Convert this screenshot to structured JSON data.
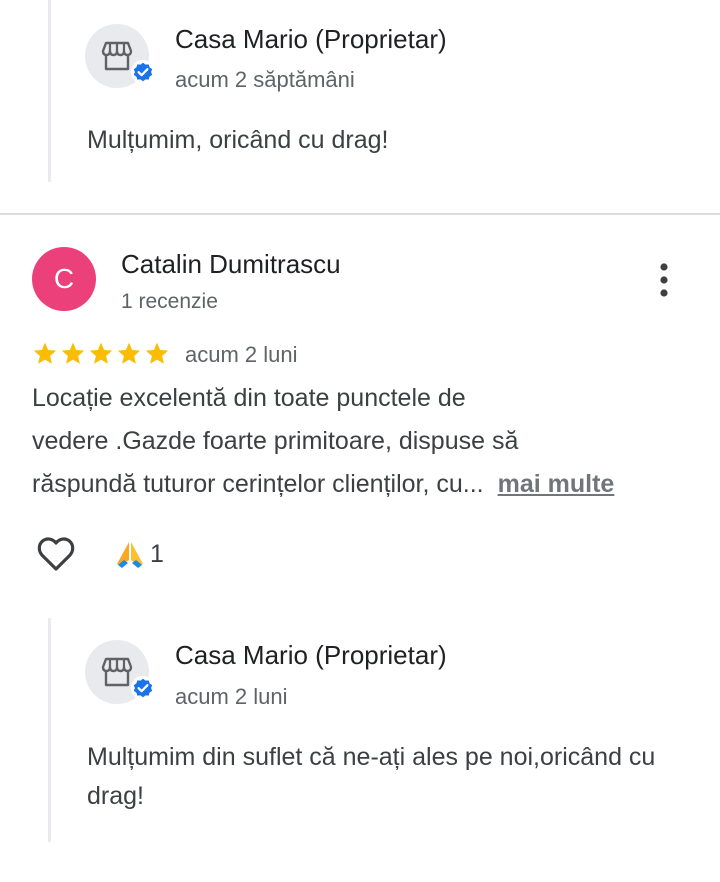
{
  "replies": [
    {
      "owner_name": "Casa Mario (Proprietar)",
      "time": "acum 2 săptămâni",
      "text": "Mulțumim, oricând cu drag!"
    },
    {
      "owner_name": "Casa Mario (Proprietar)",
      "time": "acum 2 luni",
      "text": "Mulțumim din suflet că ne-ați ales pe noi,oricând cu drag!"
    }
  ],
  "review": {
    "avatar_letter": "C",
    "avatar_color": "#ec407a",
    "reviewer_name": "Catalin Dumitrascu",
    "reviewer_meta": "1 recenzie",
    "rating": 5,
    "rating_max": 5,
    "time": "acum 2 luni",
    "text_lines": [
      "Locație excelentă din toate punctele de",
      "vedere .Gazde foarte primitoare, dispuse să",
      "răspundă tuturor cerințelor clienților, cu..."
    ],
    "more_label": "mai multe",
    "reaction_count": "1"
  },
  "icons": {
    "owner_avatar": "store-icon",
    "verified": "verified-check-icon",
    "menu": "more-vertical-icon",
    "like": "heart-icon",
    "reaction": "folded-hands-icon",
    "star": "star-icon"
  },
  "colors": {
    "star": "#fbbc04",
    "verified": "#1a73e8",
    "link": "#70757a"
  }
}
